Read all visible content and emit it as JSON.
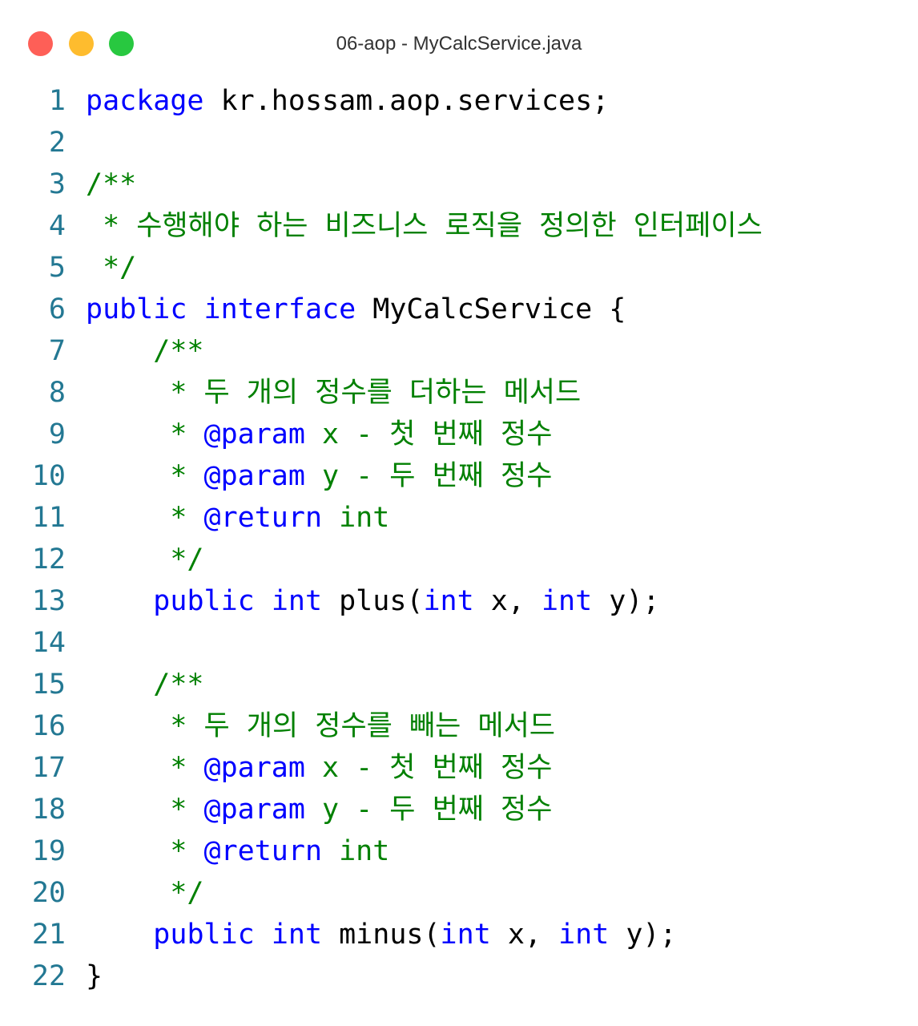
{
  "window": {
    "title": "06-aop - MyCalcService.java",
    "controls": {
      "close_color": "#fe5f57",
      "minimize_color": "#febc2e",
      "maximize_color": "#28c840"
    }
  },
  "colors": {
    "keyword": "#0000ff",
    "comment": "#008000",
    "line_number": "#237893",
    "text": "#000000"
  },
  "lines": [
    {
      "n": "1",
      "tokens": [
        {
          "t": "package",
          "c": "kw"
        },
        {
          "t": " kr.hossam.aop.services;",
          "c": "pl"
        }
      ]
    },
    {
      "n": "2",
      "tokens": []
    },
    {
      "n": "3",
      "tokens": [
        {
          "t": "/**",
          "c": "cm"
        }
      ]
    },
    {
      "n": "4",
      "tokens": [
        {
          "t": " * 수행해야 하는 비즈니스 로직을 정의한 인터페이스",
          "c": "cm"
        }
      ]
    },
    {
      "n": "5",
      "tokens": [
        {
          "t": " */",
          "c": "cm"
        }
      ]
    },
    {
      "n": "6",
      "tokens": [
        {
          "t": "public",
          "c": "kw"
        },
        {
          "t": " ",
          "c": "pl"
        },
        {
          "t": "interface",
          "c": "kw"
        },
        {
          "t": " MyCalcService {",
          "c": "pl"
        }
      ]
    },
    {
      "n": "7",
      "tokens": [
        {
          "t": "    /**",
          "c": "cm"
        }
      ]
    },
    {
      "n": "8",
      "tokens": [
        {
          "t": "     * 두 개의 정수를 더하는 메서드",
          "c": "cm"
        }
      ]
    },
    {
      "n": "9",
      "tokens": [
        {
          "t": "     * ",
          "c": "cm"
        },
        {
          "t": "@param",
          "c": "tag"
        },
        {
          "t": " x - 첫 번째 정수",
          "c": "cm"
        }
      ]
    },
    {
      "n": "10",
      "tokens": [
        {
          "t": "     * ",
          "c": "cm"
        },
        {
          "t": "@param",
          "c": "tag"
        },
        {
          "t": " y - 두 번째 정수",
          "c": "cm"
        }
      ]
    },
    {
      "n": "11",
      "tokens": [
        {
          "t": "     * ",
          "c": "cm"
        },
        {
          "t": "@return",
          "c": "tag"
        },
        {
          "t": " int",
          "c": "cm"
        }
      ]
    },
    {
      "n": "12",
      "tokens": [
        {
          "t": "     */",
          "c": "cm"
        }
      ]
    },
    {
      "n": "13",
      "tokens": [
        {
          "t": "    ",
          "c": "pl"
        },
        {
          "t": "public",
          "c": "kw"
        },
        {
          "t": " ",
          "c": "pl"
        },
        {
          "t": "int",
          "c": "kw"
        },
        {
          "t": " plus(",
          "c": "pl"
        },
        {
          "t": "int",
          "c": "kw"
        },
        {
          "t": " x, ",
          "c": "pl"
        },
        {
          "t": "int",
          "c": "kw"
        },
        {
          "t": " y);",
          "c": "pl"
        }
      ]
    },
    {
      "n": "14",
      "tokens": []
    },
    {
      "n": "15",
      "tokens": [
        {
          "t": "    /**",
          "c": "cm"
        }
      ]
    },
    {
      "n": "16",
      "tokens": [
        {
          "t": "     * 두 개의 정수를 빼는 메서드",
          "c": "cm"
        }
      ]
    },
    {
      "n": "17",
      "tokens": [
        {
          "t": "     * ",
          "c": "cm"
        },
        {
          "t": "@param",
          "c": "tag"
        },
        {
          "t": " x - 첫 번째 정수",
          "c": "cm"
        }
      ]
    },
    {
      "n": "18",
      "tokens": [
        {
          "t": "     * ",
          "c": "cm"
        },
        {
          "t": "@param",
          "c": "tag"
        },
        {
          "t": " y - 두 번째 정수",
          "c": "cm"
        }
      ]
    },
    {
      "n": "19",
      "tokens": [
        {
          "t": "     * ",
          "c": "cm"
        },
        {
          "t": "@return",
          "c": "tag"
        },
        {
          "t": " int",
          "c": "cm"
        }
      ]
    },
    {
      "n": "20",
      "tokens": [
        {
          "t": "     */",
          "c": "cm"
        }
      ]
    },
    {
      "n": "21",
      "tokens": [
        {
          "t": "    ",
          "c": "pl"
        },
        {
          "t": "public",
          "c": "kw"
        },
        {
          "t": " ",
          "c": "pl"
        },
        {
          "t": "int",
          "c": "kw"
        },
        {
          "t": " minus(",
          "c": "pl"
        },
        {
          "t": "int",
          "c": "kw"
        },
        {
          "t": " x, ",
          "c": "pl"
        },
        {
          "t": "int",
          "c": "kw"
        },
        {
          "t": " y);",
          "c": "pl"
        }
      ]
    },
    {
      "n": "22",
      "tokens": [
        {
          "t": "}",
          "c": "pl"
        }
      ]
    }
  ]
}
